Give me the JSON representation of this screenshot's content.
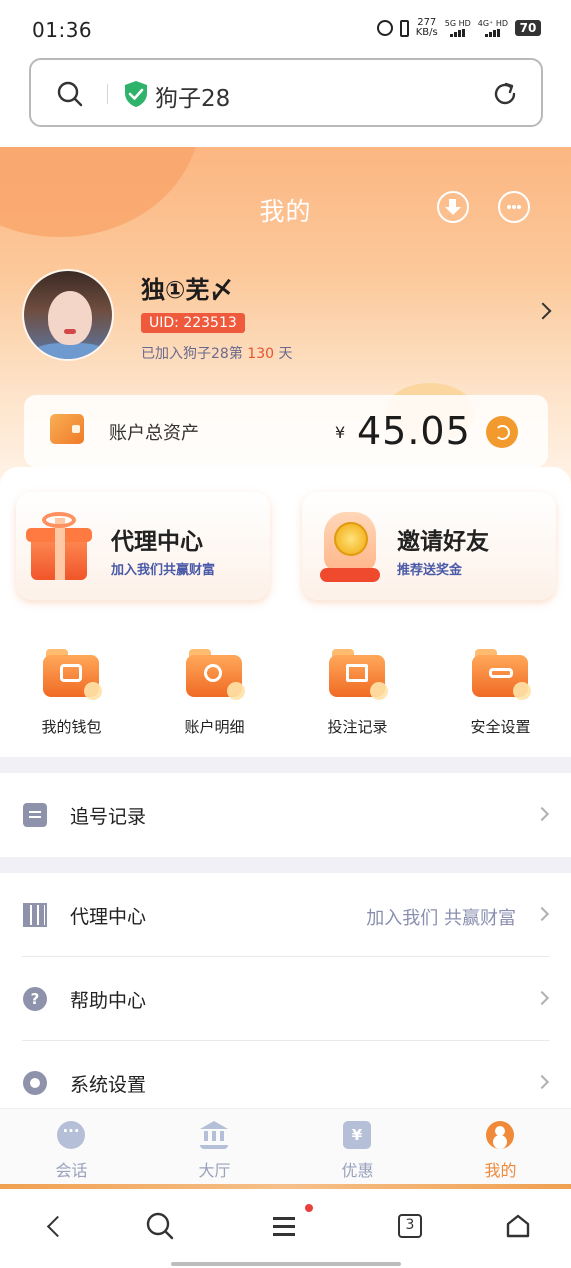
{
  "status_bar": {
    "time": "01:36",
    "speed_value": "277",
    "speed_unit": "KB/s",
    "net1": "5G HD",
    "net2": "4G⁺ HD",
    "battery": "70"
  },
  "browser": {
    "url_text": "狗子28",
    "tab_count": "3"
  },
  "header": {
    "title": "我的"
  },
  "profile": {
    "name": "独①芜〆",
    "uid": "UID: 223513",
    "join_prefix": "已加入狗子28第",
    "join_days": "130",
    "join_suffix": "天"
  },
  "asset": {
    "label": "账户总资产",
    "currency": "¥",
    "value": "45.05"
  },
  "promos": [
    {
      "title": "代理中心",
      "subtitle": "加入我们共赢财富"
    },
    {
      "title": "邀请好友",
      "subtitle": "推荐送奖金"
    }
  ],
  "quick_actions": [
    {
      "label": "我的钱包",
      "icon": "wallet-folder-icon"
    },
    {
      "label": "账户明细",
      "icon": "magnifier-folder-icon"
    },
    {
      "label": "投注记录",
      "icon": "calendar-folder-icon"
    },
    {
      "label": "安全设置",
      "icon": "key-folder-icon"
    }
  ],
  "menu": {
    "chase": {
      "label": "追号记录"
    },
    "agent": {
      "label": "代理中心",
      "hint": "加入我们 共赢财富"
    },
    "help": {
      "label": "帮助中心"
    },
    "settings": {
      "label": "系统设置"
    }
  },
  "tabbar": [
    {
      "label": "会话",
      "icon": "chat-bubble-icon"
    },
    {
      "label": "大厅",
      "icon": "bank-building-icon"
    },
    {
      "label": "优惠",
      "icon": "yen-coupon-icon"
    },
    {
      "label": "我的",
      "icon": "user-profile-icon",
      "active": true
    }
  ],
  "colors": {
    "accent": "#f08a3a",
    "uid_badge": "#ef5a3c",
    "muted_icon": "#8e93ab",
    "tab_inactive": "#9aa1bd"
  }
}
